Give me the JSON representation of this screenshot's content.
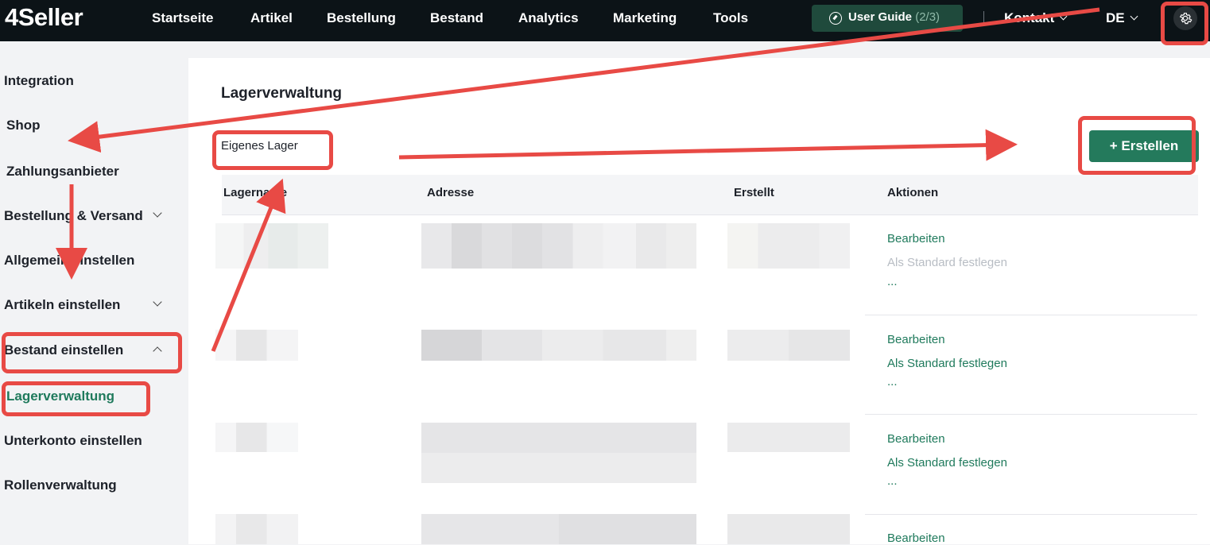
{
  "header": {
    "logo": "4Seller",
    "nav": [
      "Startseite",
      "Artikel",
      "Bestellung",
      "Bestand",
      "Analytics",
      "Marketing",
      "Tools"
    ],
    "user_guide": {
      "label": "User Guide",
      "progress": "(2/3)",
      "icon": "compass-icon"
    },
    "contact": "Kontakt",
    "language": "DE",
    "settings_icon": "gear-icon"
  },
  "sidebar": {
    "items": [
      {
        "label": "Integration"
      },
      {
        "label": "Shop"
      },
      {
        "label": "Zahlungsanbieter"
      },
      {
        "label": "Bestellung & Versand"
      },
      {
        "label": "Allgemein einstellen"
      },
      {
        "label": "Artikeln einstellen"
      },
      {
        "label": "Bestand einstellen"
      },
      {
        "label": "Lagerverwaltung"
      },
      {
        "label": "Unterkonto einstellen"
      },
      {
        "label": "Rollenverwaltung"
      }
    ]
  },
  "main": {
    "title": "Lagerverwaltung",
    "tab": "Eigenes Lager",
    "create_button": "+ Erstellen",
    "columns": [
      "Lagername",
      "Adresse",
      "Erstellt",
      "Aktionen"
    ],
    "rows": [
      {
        "edit": "Bearbeiten",
        "set_default": "Als Standard festlegen",
        "more": "...",
        "set_default_disabled": true
      },
      {
        "edit": "Bearbeiten",
        "set_default": "Als Standard festlegen",
        "more": "...",
        "set_default_disabled": false
      },
      {
        "edit": "Bearbeiten",
        "set_default": "Als Standard festlegen",
        "more": "...",
        "set_default_disabled": false
      },
      {
        "edit": "Bearbeiten"
      }
    ]
  },
  "colors": {
    "topbar": "#0c1317",
    "accent": "#247a5c",
    "annotation": "#e84a45"
  }
}
